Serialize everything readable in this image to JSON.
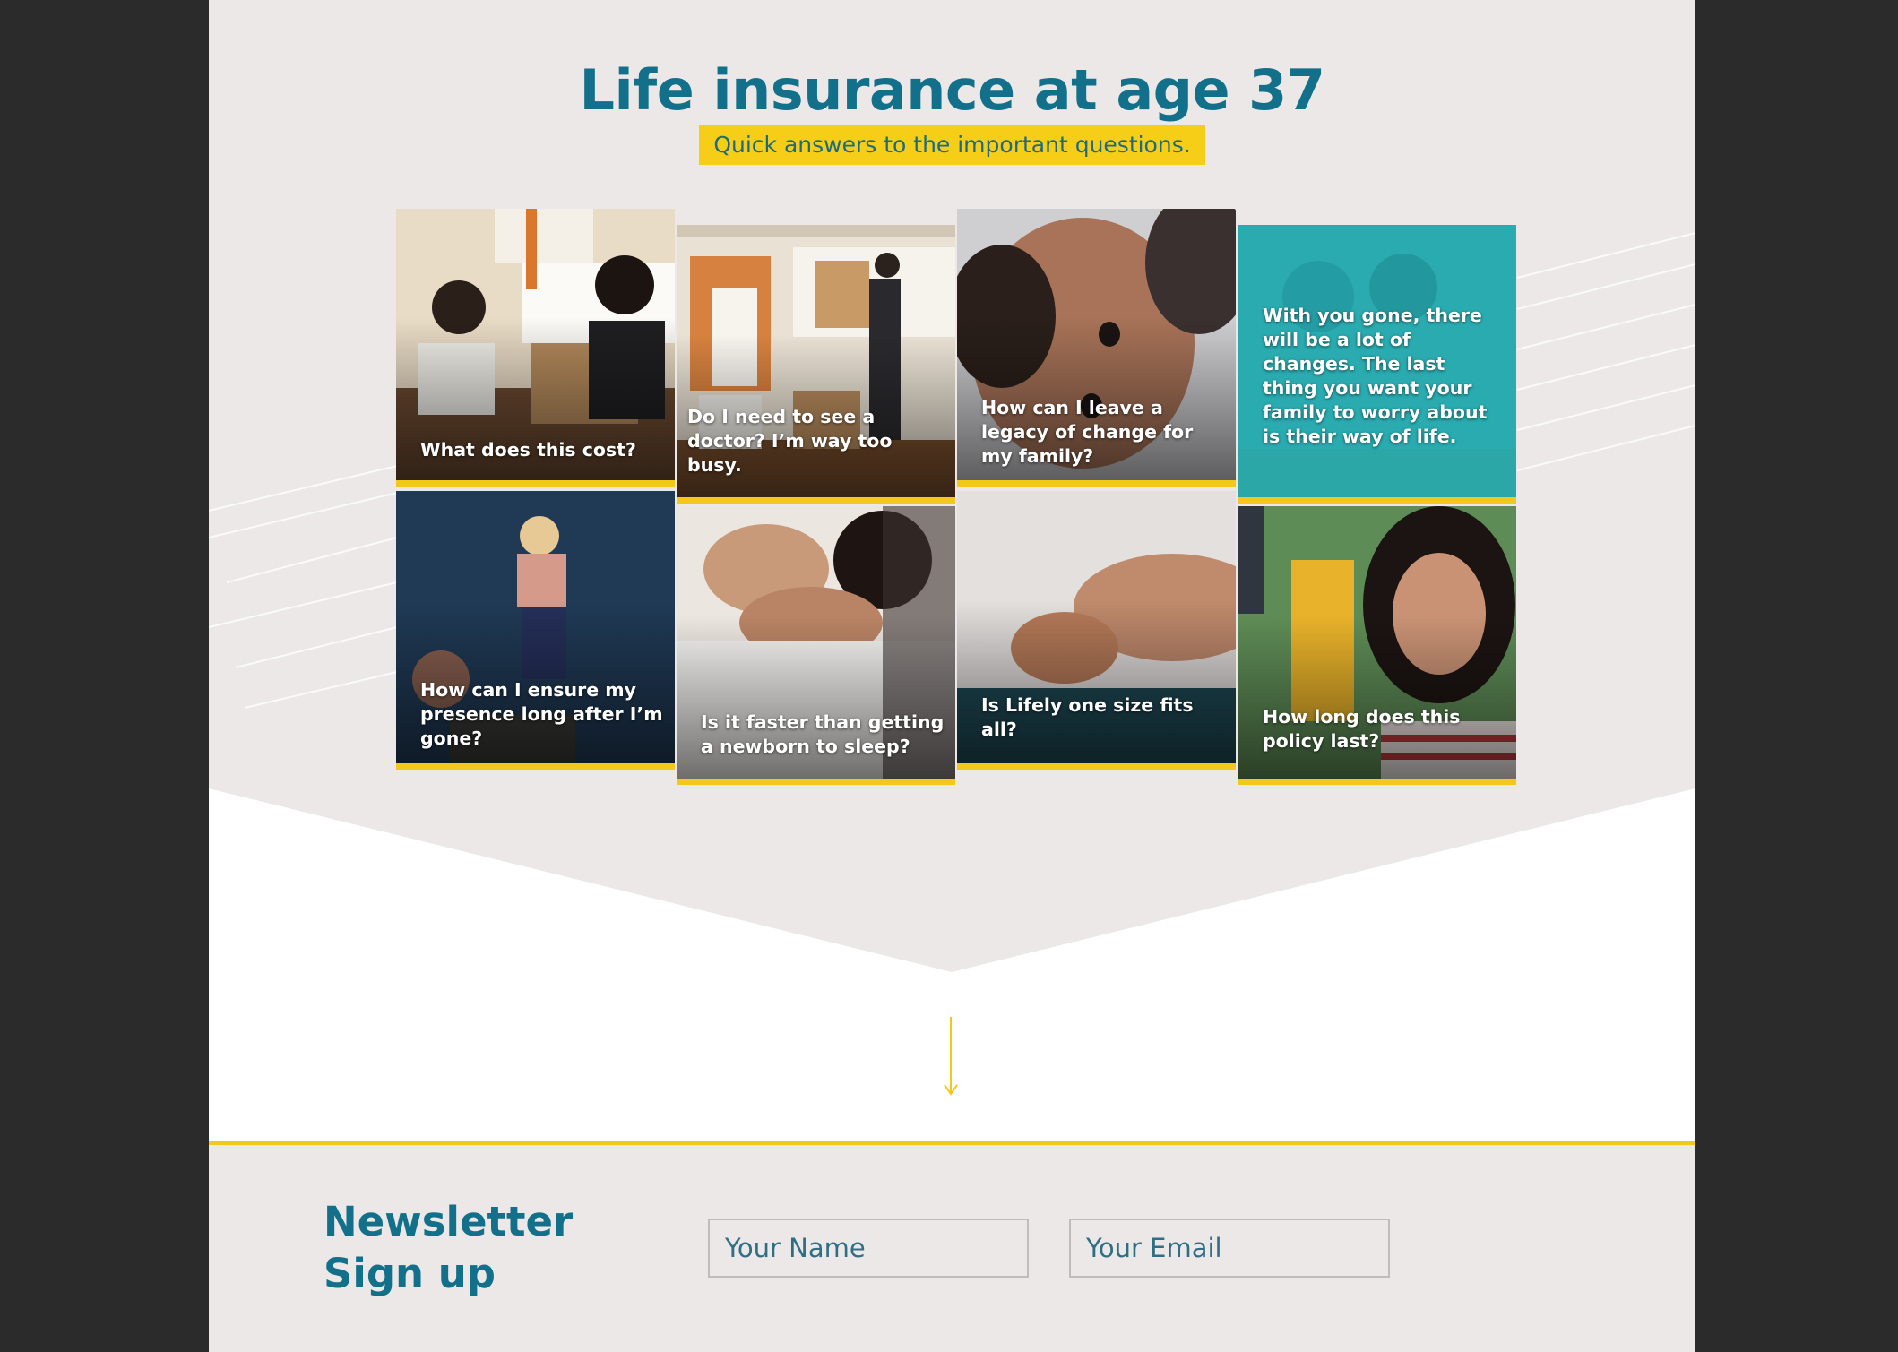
{
  "page": {
    "title": "Life insurance at age 37",
    "subtitle": "Quick answers to the important questions."
  },
  "tiles": [
    {
      "caption": "What does this cost?"
    },
    {
      "caption": "Do I need to see a doctor? I’m way too busy."
    },
    {
      "caption": "How can I leave a legacy of change for my family?"
    },
    {
      "caption": "With you gone, there will be a lot of changes. The last thing you want your family to worry about is their way of life."
    },
    {
      "caption": "How can I ensure my presence long after I’m gone?"
    },
    {
      "caption": "Is it faster than getting a newborn to sleep?"
    },
    {
      "caption": "Is Lifely one size fits all?"
    },
    {
      "caption": "How long does this policy last?"
    }
  ],
  "newsletter": {
    "title": "Newsletter Sign up",
    "name_placeholder": "Your Name",
    "email_placeholder": "Your Email"
  },
  "colors": {
    "brand_teal": "#12708a",
    "accent_yellow": "#f4c81a",
    "background": "#ece8e8"
  },
  "icons": {
    "scroll_indicator": "arrow-down-icon"
  }
}
